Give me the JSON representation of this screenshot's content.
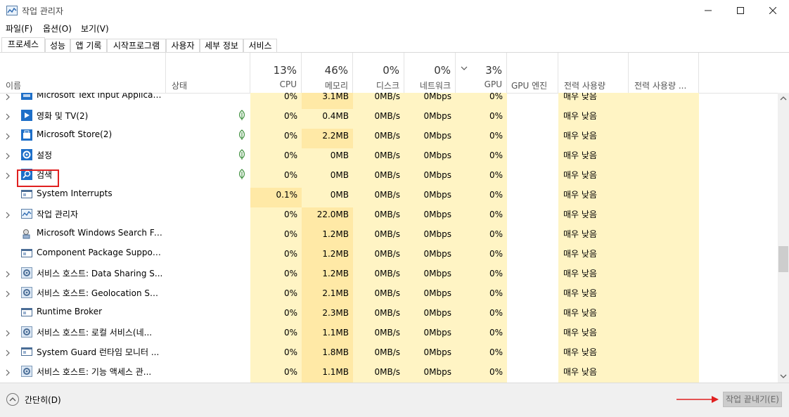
{
  "window": {
    "title": "작업 관리자"
  },
  "menu": [
    "파일(F)",
    "옵션(O)",
    "보기(V)"
  ],
  "tabs": [
    "프로세스",
    "성능",
    "앱 기록",
    "시작프로그램",
    "사용자",
    "세부 정보",
    "서비스"
  ],
  "header": {
    "name": "이름",
    "status": "상태",
    "cpu_pct": "13%",
    "cpu": "CPU",
    "mem_pct": "46%",
    "mem": "메모리",
    "disk_pct": "0%",
    "disk": "디스크",
    "net_pct": "0%",
    "net": "네트워크",
    "gpu_pct": "3%",
    "gpu": "GPU",
    "gpu_engine": "GPU 엔진",
    "power": "전력 사용량",
    "power_trend": "전력 사용량 ..."
  },
  "rows": [
    {
      "name": "Microsoft Text Input Application",
      "expand": true,
      "leaf": false,
      "cpu": "0%",
      "mem": "3.1MB",
      "disk": "0MB/s",
      "net": "0Mbps",
      "gpu": "0%",
      "power": "매우 낮음",
      "icon": "text-input-icon"
    },
    {
      "name": "영화 및 TV(2)",
      "expand": true,
      "leaf": true,
      "cpu": "0%",
      "mem": "0.4MB",
      "disk": "0MB/s",
      "net": "0Mbps",
      "gpu": "0%",
      "power": "매우 낮음",
      "icon": "movies-tv-icon"
    },
    {
      "name": "Microsoft Store(2)",
      "expand": true,
      "leaf": true,
      "cpu": "0%",
      "mem": "2.2MB",
      "disk": "0MB/s",
      "net": "0Mbps",
      "gpu": "0%",
      "power": "매우 낮음",
      "icon": "store-icon"
    },
    {
      "name": "설정",
      "expand": true,
      "leaf": true,
      "cpu": "0%",
      "mem": "0MB",
      "disk": "0MB/s",
      "net": "0Mbps",
      "gpu": "0%",
      "power": "매우 낮음",
      "icon": "settings-icon"
    },
    {
      "name": "검색",
      "expand": true,
      "leaf": true,
      "cpu": "0%",
      "mem": "0MB",
      "disk": "0MB/s",
      "net": "0Mbps",
      "gpu": "0%",
      "power": "매우 낮음",
      "icon": "search-icon"
    },
    {
      "name": "System Interrupts",
      "expand": false,
      "leaf": false,
      "cpu": "0.1%",
      "mem": "0MB",
      "disk": "0MB/s",
      "net": "0Mbps",
      "gpu": "0%",
      "power": "매우 낮음",
      "icon": "system-window-icon"
    },
    {
      "name": "작업 관리자",
      "expand": true,
      "leaf": false,
      "cpu": "0%",
      "mem": "22.0MB",
      "disk": "0MB/s",
      "net": "0Mbps",
      "gpu": "0%",
      "power": "매우 낮음",
      "icon": "task-manager-icon"
    },
    {
      "name": "Microsoft Windows Search Filt...",
      "expand": false,
      "leaf": false,
      "cpu": "0%",
      "mem": "1.2MB",
      "disk": "0MB/s",
      "net": "0Mbps",
      "gpu": "0%",
      "power": "매우 낮음",
      "icon": "search-filter-icon"
    },
    {
      "name": "Component Package Support ...",
      "expand": false,
      "leaf": false,
      "cpu": "0%",
      "mem": "1.2MB",
      "disk": "0MB/s",
      "net": "0Mbps",
      "gpu": "0%",
      "power": "매우 낮음",
      "icon": "system-window-icon"
    },
    {
      "name": "서비스 호스트: Data Sharing S...",
      "expand": true,
      "leaf": false,
      "cpu": "0%",
      "mem": "1.2MB",
      "disk": "0MB/s",
      "net": "0Mbps",
      "gpu": "0%",
      "power": "매우 낮음",
      "icon": "service-host-icon"
    },
    {
      "name": "서비스 호스트: Geolocation Ser...",
      "expand": true,
      "leaf": false,
      "cpu": "0%",
      "mem": "2.1MB",
      "disk": "0MB/s",
      "net": "0Mbps",
      "gpu": "0%",
      "power": "매우 낮음",
      "icon": "service-host-icon"
    },
    {
      "name": "Runtime Broker",
      "expand": false,
      "leaf": false,
      "cpu": "0%",
      "mem": "2.3MB",
      "disk": "0MB/s",
      "net": "0Mbps",
      "gpu": "0%",
      "power": "매우 낮음",
      "icon": "system-window-icon"
    },
    {
      "name": "서비스 호스트: 로컬 서비스(네...",
      "expand": true,
      "leaf": false,
      "cpu": "0%",
      "mem": "1.1MB",
      "disk": "0MB/s",
      "net": "0Mbps",
      "gpu": "0%",
      "power": "매우 낮음",
      "icon": "service-host-icon"
    },
    {
      "name": "System Guard 런타임 모니터 ...",
      "expand": true,
      "leaf": false,
      "cpu": "0%",
      "mem": "1.8MB",
      "disk": "0MB/s",
      "net": "0Mbps",
      "gpu": "0%",
      "power": "매우 낮음",
      "icon": "system-window-icon"
    },
    {
      "name": "서비스 호스트: 기능 액세스 관...",
      "expand": true,
      "leaf": false,
      "cpu": "0%",
      "mem": "1.1MB",
      "disk": "0MB/s",
      "net": "0Mbps",
      "gpu": "0%",
      "power": "매우 낮음",
      "icon": "service-host-icon"
    }
  ],
  "footer": {
    "fewer_details": "간단히(D)",
    "end_task": "작업 끝내기(E)"
  },
  "colors": {
    "heat_light": "#fff4c4",
    "heat_mid": "#ffe9a6",
    "annotation_red": "#e02020",
    "accent_blue": "#1e6fc8",
    "leaf_green": "#3a8c3a"
  }
}
